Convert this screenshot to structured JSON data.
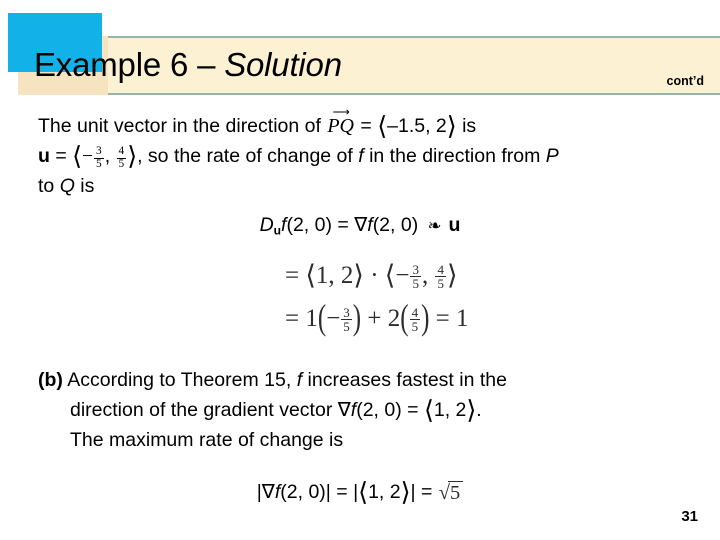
{
  "slide": {
    "title_plain": "Example 6 – ",
    "title_italic": "Solution",
    "contd": "cont’d",
    "page_number": "31",
    "accent_color": "#12b1e8",
    "banner_color": "#fdf1d4",
    "banner_border_color": "#93b6a8",
    "banner_shadow_color": "#f6e3bf"
  },
  "body": {
    "line1": {
      "before_vector": "The unit vector in the direction of ",
      "vector_label": "PQ",
      "vector_arrow": "⟶",
      "equals": " = ",
      "open_angle": "⟨",
      "components": "–1.5, 2",
      "close_angle": "⟩",
      "after": " is"
    },
    "line2": {
      "u_symbol": "u",
      "equals": " = ",
      "open_angle": "⟨",
      "minus": "−",
      "frac1_num": "3",
      "frac1_den": "5",
      "comma": ", ",
      "frac2_num": "4",
      "frac2_den": "5",
      "close_angle": "⟩",
      "after": ", so the rate of change of ",
      "f_italic": "f",
      "after2": " in the direction from ",
      "p_italic": "P"
    },
    "line3": {
      "text_a": "to ",
      "q_italic": "Q",
      "text_b": " is"
    }
  },
  "derivative_line": {
    "d_symbol": "D",
    "subscript": "u",
    "f_italic": "f",
    "args1": "(2, 0)",
    "equals": " = ",
    "nabla": "∇",
    "f_italic2": "f",
    "args2": "(2, 0) ",
    "dot_operator": "❧",
    "u_vector": "u"
  },
  "math": {
    "line1": {
      "equals": "= ",
      "open_angle": "⟨",
      "vec_a": "1, 2",
      "close_angle": "⟩",
      "dot": " · ",
      "open_angle2": "⟨",
      "minus": "−",
      "frac1_num": "3",
      "frac1_den": "5",
      "comma": ", ",
      "frac2_num": "4",
      "frac2_den": "5",
      "close_angle2": "⟩"
    },
    "line2": {
      "equals": "= ",
      "coef1": "1",
      "open_paren": "(",
      "minus": "−",
      "frac1_num": "3",
      "frac1_den": "5",
      "close_paren": ")",
      "plus": " + ",
      "coef2": "2",
      "open_paren2": "(",
      "frac2_num": "4",
      "frac2_den": "5",
      "close_paren2": ")",
      "equals2": " = ",
      "result": "1"
    }
  },
  "part_b": {
    "label": "(b)",
    "line1": " According to Theorem 15, ",
    "f_italic": "f",
    "line1b": " increases fastest in the",
    "line2a": "direction of the gradient vector ",
    "nabla": "∇",
    "f_italic2": "f",
    "line2b": "(2, 0) = ",
    "open_angle": "⟨",
    "vec": "1, 2",
    "close_angle": "⟩",
    "period": ".",
    "line3": "The maximum rate of change is"
  },
  "final_line": {
    "bar1": "|",
    "nabla": "∇",
    "f_italic": "f",
    "args": "(2, 0)",
    "bar2": "|",
    "equals": " = ",
    "bar3": "|",
    "open_angle": "⟨",
    "vec": "1, 2",
    "close_angle": "⟩",
    "bar4": "|",
    "equals2": " = ",
    "sqrt_symbol": "√",
    "radicand": "5"
  }
}
